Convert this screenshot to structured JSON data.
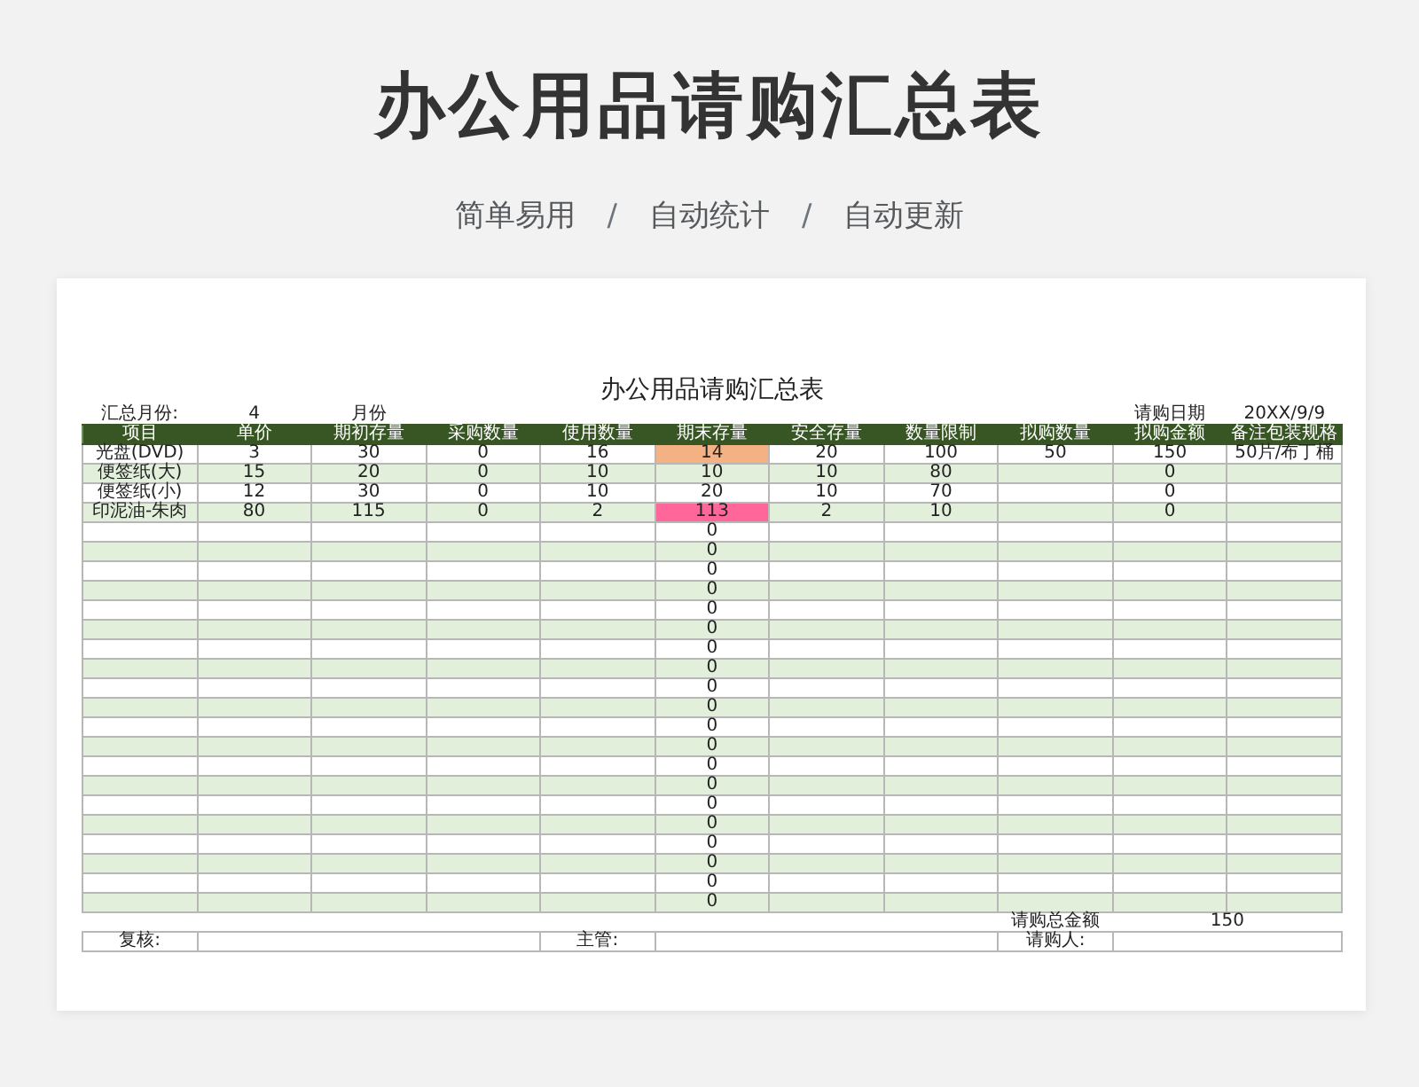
{
  "title": "办公用品请购汇总表",
  "subtitle": [
    {
      "kind": "tag",
      "text": "简单易用"
    },
    {
      "kind": "sep",
      "text": "/"
    },
    {
      "kind": "tag",
      "text": "自动统计"
    },
    {
      "kind": "sep",
      "text": "/"
    },
    {
      "kind": "tag",
      "text": "自动更新"
    }
  ],
  "sheet": {
    "title": "办公用品请购汇总表",
    "meta": {
      "month_label": "汇总月份:",
      "month_value": "4",
      "month_unit": "月份",
      "date_label": "请购日期",
      "date_value": "20XX/9/9"
    },
    "columns": [
      "项目",
      "单价",
      "期初存量",
      "采购数量",
      "使用数量",
      "期末存量",
      "安全存量",
      "数量限制",
      "拟购数量",
      "拟购金额",
      "备注包装规格"
    ],
    "rows": [
      {
        "cells": [
          "光盘(DVD)",
          "3",
          "30",
          "0",
          "16",
          "14",
          "20",
          "100",
          "50",
          "150",
          "50片/布丁桶"
        ],
        "color": "#f4b183"
      },
      {
        "cells": [
          "便签纸(大)",
          "15",
          "20",
          "0",
          "10",
          "10",
          "10",
          "80",
          null,
          "0",
          null
        ]
      },
      {
        "cells": [
          "便签纸(小)",
          "12",
          "30",
          "0",
          "10",
          "20",
          "10",
          "70",
          null,
          "0",
          null
        ]
      },
      {
        "cells": [
          "印泥油-朱肉",
          "80",
          "115",
          "0",
          "2",
          "113",
          "2",
          "10",
          null,
          "0",
          null
        ],
        "color": "#ff6699"
      },
      {
        "cells": [
          null,
          null,
          null,
          null,
          null,
          "0",
          null,
          null,
          null,
          null,
          null
        ]
      },
      {
        "cells": [
          null,
          null,
          null,
          null,
          null,
          "0",
          null,
          null,
          null,
          null,
          null
        ]
      },
      {
        "cells": [
          null,
          null,
          null,
          null,
          null,
          "0",
          null,
          null,
          null,
          null,
          null
        ]
      },
      {
        "cells": [
          null,
          null,
          null,
          null,
          null,
          "0",
          null,
          null,
          null,
          null,
          null
        ]
      },
      {
        "cells": [
          null,
          null,
          null,
          null,
          null,
          "0",
          null,
          null,
          null,
          null,
          null
        ]
      },
      {
        "cells": [
          null,
          null,
          null,
          null,
          null,
          "0",
          null,
          null,
          null,
          null,
          null
        ]
      },
      {
        "cells": [
          null,
          null,
          null,
          null,
          null,
          "0",
          null,
          null,
          null,
          null,
          null
        ]
      },
      {
        "cells": [
          null,
          null,
          null,
          null,
          null,
          "0",
          null,
          null,
          null,
          null,
          null
        ]
      },
      {
        "cells": [
          null,
          null,
          null,
          null,
          null,
          "0",
          null,
          null,
          null,
          null,
          null
        ]
      },
      {
        "cells": [
          null,
          null,
          null,
          null,
          null,
          "0",
          null,
          null,
          null,
          null,
          null
        ]
      },
      {
        "cells": [
          null,
          null,
          null,
          null,
          null,
          "0",
          null,
          null,
          null,
          null,
          null
        ]
      },
      {
        "cells": [
          null,
          null,
          null,
          null,
          null,
          "0",
          null,
          null,
          null,
          null,
          null
        ]
      },
      {
        "cells": [
          null,
          null,
          null,
          null,
          null,
          "0",
          null,
          null,
          null,
          null,
          null
        ]
      },
      {
        "cells": [
          null,
          null,
          null,
          null,
          null,
          "0",
          null,
          null,
          null,
          null,
          null
        ]
      },
      {
        "cells": [
          null,
          null,
          null,
          null,
          null,
          "0",
          null,
          null,
          null,
          null,
          null
        ]
      },
      {
        "cells": [
          null,
          null,
          null,
          null,
          null,
          "0",
          null,
          null,
          null,
          null,
          null
        ]
      },
      {
        "cells": [
          null,
          null,
          null,
          null,
          null,
          "0",
          null,
          null,
          null,
          null,
          null
        ]
      },
      {
        "cells": [
          null,
          null,
          null,
          null,
          null,
          "0",
          null,
          null,
          null,
          null,
          null
        ]
      },
      {
        "cells": [
          null,
          null,
          null,
          null,
          null,
          "0",
          null,
          null,
          null,
          null,
          null
        ]
      },
      {
        "cells": [
          null,
          null,
          null,
          null,
          null,
          "0",
          null,
          null,
          null,
          null,
          null
        ]
      }
    ],
    "total": {
      "label": "请购总金额",
      "value": "150"
    },
    "signatures": [
      {
        "label": "复核:"
      },
      {
        "label": "主管:"
      },
      {
        "label": "请购人:"
      }
    ]
  }
}
